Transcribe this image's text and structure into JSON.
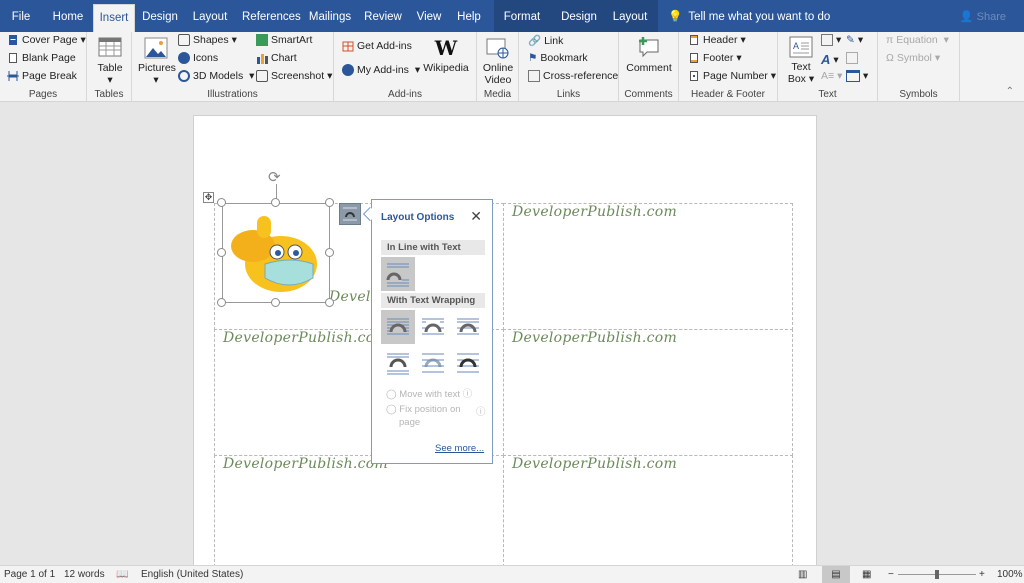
{
  "tabs": [
    {
      "label": "File"
    },
    {
      "label": "Home"
    },
    {
      "label": "Insert",
      "active": true
    },
    {
      "label": "Design"
    },
    {
      "label": "Layout"
    },
    {
      "label": "References"
    },
    {
      "label": "Mailings"
    },
    {
      "label": "Review"
    },
    {
      "label": "View"
    },
    {
      "label": "Help"
    },
    {
      "label": "Format"
    },
    {
      "label": "Design"
    },
    {
      "label": "Layout"
    }
  ],
  "tell_me": "Tell me what you want to do",
  "share": "Share",
  "ribbon": {
    "pages": {
      "label": "Pages",
      "items": [
        "Cover Page",
        "Blank Page",
        "Page Break"
      ]
    },
    "tables": {
      "label": "Tables",
      "items": [
        "Table"
      ]
    },
    "illustrations": {
      "label": "Illustrations",
      "pictures": "Pictures",
      "items": [
        "Shapes",
        "Icons",
        "3D Models",
        "SmartArt",
        "Chart",
        "Screenshot"
      ]
    },
    "addins": {
      "label": "Add-ins",
      "items": [
        "Get Add-ins",
        "My Add-ins",
        "Wikipedia"
      ]
    },
    "media": {
      "label": "Media",
      "items": [
        "Online",
        "Video"
      ]
    },
    "links": {
      "label": "Links",
      "items": [
        "Link",
        "Bookmark",
        "Cross-reference"
      ]
    },
    "comments": {
      "label": "Comments",
      "items": [
        "Comment"
      ]
    },
    "header_footer": {
      "label": "Header & Footer",
      "items": [
        "Header",
        "Footer",
        "Page Number"
      ]
    },
    "text": {
      "label": "Text",
      "items": [
        "Text",
        "Box"
      ]
    },
    "symbols": {
      "label": "Symbols",
      "items": [
        "Equation",
        "Symbol"
      ]
    }
  },
  "document": {
    "cell_text": "DeveloperPublish.com",
    "partial_text": "Develo"
  },
  "layout_options": {
    "title": "Layout Options",
    "inline_header": "In Line with Text",
    "wrap_header": "With Text Wrapping",
    "move_with_text": "Move with text",
    "fix_position": "Fix position on",
    "fix_position_2": "page",
    "see_more": "See more..."
  },
  "status": {
    "page": "Page 1 of 1",
    "words": "12 words",
    "language": "English (United States)",
    "zoom": "100%",
    "zoom_minus": "−",
    "zoom_plus": "+"
  }
}
